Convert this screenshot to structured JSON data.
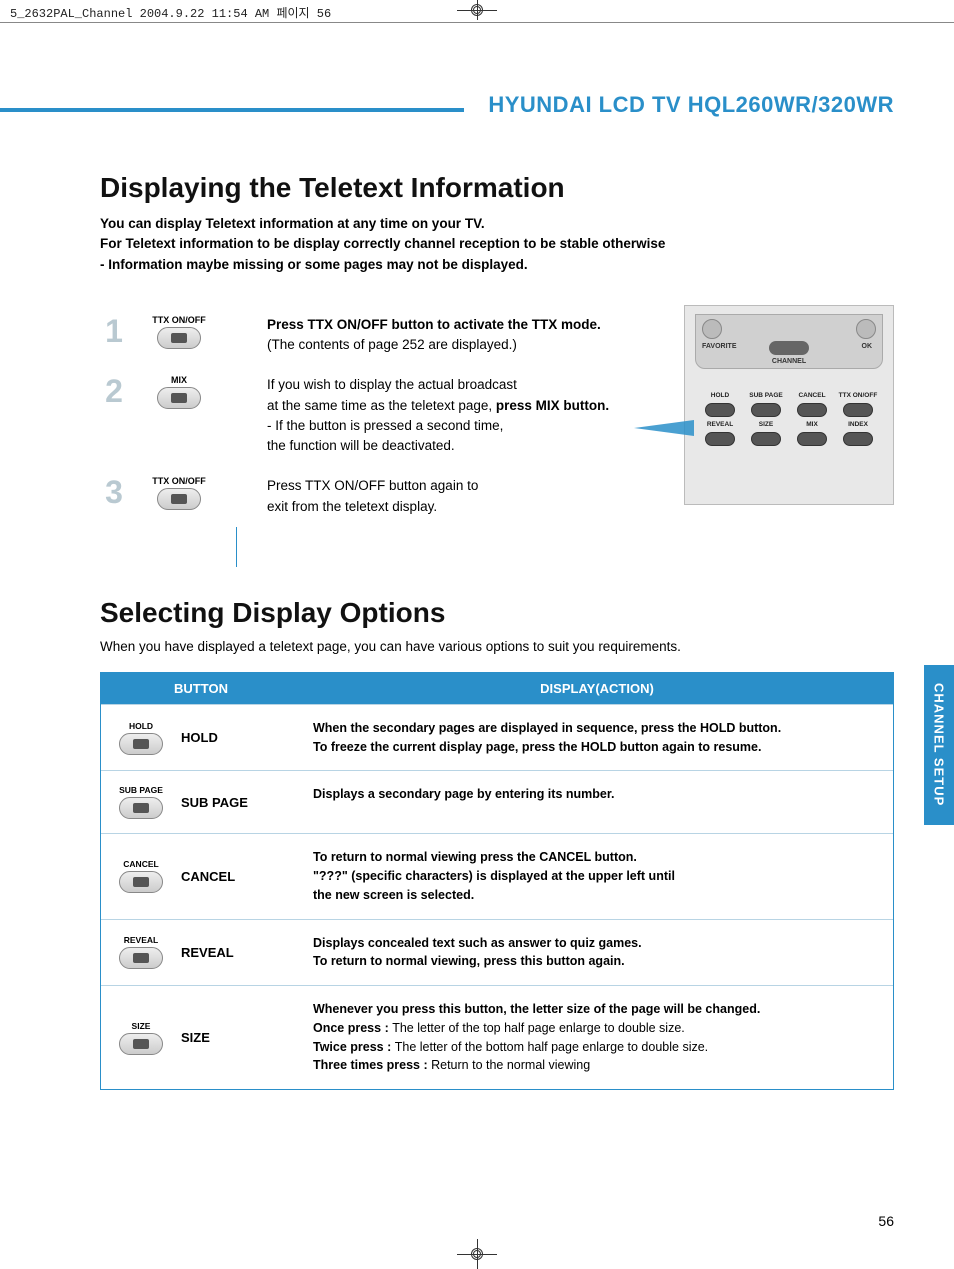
{
  "print_header": "5_2632PAL_Channel  2004.9.22 11:54 AM  페이지 56",
  "section_title": "HYUNDAI LCD TV HQL260WR/320WR",
  "side_tab": "CHANNEL SETUP",
  "page_number": "56",
  "title1": "Displaying the Teletext Information",
  "intro_lines": [
    "You can display Teletext information at any time on your TV.",
    "For Teletext information to be display correctly channel reception to be stable otherwise",
    "- Information maybe missing or some pages may not be displayed."
  ],
  "steps": [
    {
      "num": "1",
      "btn_label": "TTX ON/OFF",
      "text_bold": "Press TTX ON/OFF button to  activate the TTX mode.",
      "text_rest": "(The contents of page 252 are displayed.)"
    },
    {
      "num": "2",
      "btn_label": "MIX",
      "text_pre": "If you wish to display the actual broadcast\nat the same time as the teletext page, ",
      "text_bold_inline": "press MIX button.",
      "text_after": "- If the button is pressed a second time,\n  the function will be deactivated."
    },
    {
      "num": "3",
      "btn_label": "TTX ON/OFF",
      "text_plain": "Press TTX ON/OFF button again to\nexit from the teletext display."
    }
  ],
  "remote": {
    "favorite": "FAVORITE",
    "ok": "OK",
    "channel": "CHANNEL",
    "row1": [
      "HOLD",
      "SUB PAGE",
      "CANCEL",
      "TTX ON/OFF"
    ],
    "row2": [
      "REVEAL",
      "SIZE",
      "MIX",
      "INDEX"
    ]
  },
  "title2": "Selecting Display Options",
  "subintro": "When you have displayed a teletext page, you can have various options to suit you requirements.",
  "table_head": {
    "button": "BUTTON",
    "action": "DISPLAY(ACTION)"
  },
  "options": [
    {
      "icon_label": "HOLD",
      "name": "HOLD",
      "action": "When the secondary pages are displayed in sequence, press the HOLD button.\nTo freeze the current display page, press the HOLD button again to resume."
    },
    {
      "icon_label": "SUB PAGE",
      "name": "SUB PAGE",
      "action": "Displays a secondary page by entering its number."
    },
    {
      "icon_label": "CANCEL",
      "name": "CANCEL",
      "action": "To return to normal viewing press the CANCEL  button.\n\"???\" (specific characters) is displayed at the upper left until\nthe new screen is selected."
    },
    {
      "icon_label": "REVEAL",
      "name": "REVEAL",
      "action": "Displays concealed text such as answer to quiz games.\nTo return to normal viewing, press this button again."
    },
    {
      "icon_label": "SIZE",
      "name": "SIZE",
      "action_parts": [
        {
          "b": "Whenever you press this button, the letter size of the page will be changed."
        },
        {
          "b": "Once press : ",
          "r": "The letter of the top half page enlarge to double size."
        },
        {
          "b": "Twice press : ",
          "r": "The letter of the bottom half page enlarge to double size."
        },
        {
          "b": "Three times press : ",
          "r": "Return to the normal viewing"
        }
      ]
    }
  ]
}
